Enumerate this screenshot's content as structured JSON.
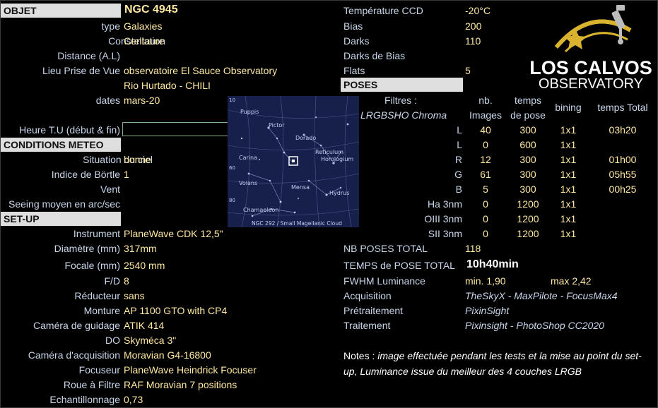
{
  "objet": {
    "header": "OBJET",
    "name": "NGC 4945",
    "rows": [
      {
        "label": "type",
        "value": "Galaxies"
      },
      {
        "label": "Constellation",
        "value": "Centaure"
      },
      {
        "label": "Distance (A.L)",
        "value": ""
      },
      {
        "label": "Lieu Prise de Vue",
        "value": "observatoire El Sauce Observatory"
      },
      {
        "label": "",
        "value": "Rio Hurtado - CHILI"
      },
      {
        "label": "dates",
        "value": "mars-20"
      }
    ],
    "heure_label": "Heure T.U (début & fin)",
    "heure_value": ""
  },
  "meteo": {
    "header": "CONDITIONS METEO",
    "rows": [
      {
        "label": "Situation du ciel",
        "value": "bonne"
      },
      {
        "label": "Indice de Börtle",
        "value": "1"
      },
      {
        "label": "Vent",
        "value": ""
      },
      {
        "label": "Seeing moyen en arc/sec",
        "value": ""
      }
    ]
  },
  "setup": {
    "header": "SET-UP",
    "rows": [
      {
        "label": "Instrument",
        "value": "PlaneWave CDK 12,5\""
      },
      {
        "label": "Diamètre (mm)",
        "value": "317mm"
      },
      {
        "label": "Focale (mm)",
        "value": "2540 mm"
      },
      {
        "label": "F/D",
        "value": "8"
      },
      {
        "label": "Réducteur",
        "value": "sans"
      },
      {
        "label": "Monture",
        "value": "AP 1100 GTO with CP4"
      },
      {
        "label": "Caméra de guidage",
        "value": "ATIK 414"
      },
      {
        "label": "DO",
        "value": "Skyméca 3\""
      },
      {
        "label": "Caméra d'acquisition",
        "value": "Moravian G4-16800"
      },
      {
        "label": "Focuseur",
        "value": "PlaneWave Heindrick Focuser"
      },
      {
        "label": "Roue à Filtre",
        "value": "RAF Moravian 7 positions"
      },
      {
        "label": "Echantillonnage",
        "value": "0,73"
      }
    ]
  },
  "camera": {
    "rows": [
      {
        "label": "Température CCD",
        "value": "-20°C"
      },
      {
        "label": "Bias",
        "value": "200"
      },
      {
        "label": "Darks",
        "value": "110"
      },
      {
        "label": "Darks de Bias",
        "value": ""
      },
      {
        "label": "Flats",
        "value": "5"
      }
    ]
  },
  "poses": {
    "header": "POSES",
    "filtres_label": "Filtres :",
    "filtres_sub": "LRGBSHO Chroma",
    "col_nb": [
      "nb.",
      "Images"
    ],
    "col_temps": [
      "temps",
      "de pose"
    ],
    "col_bining": "bining",
    "col_total": "temps Total",
    "rows": [
      {
        "filter": "L",
        "nb": "40",
        "temps": "300",
        "bin": "1x1",
        "total": "03h20"
      },
      {
        "filter": "L",
        "nb": "0",
        "temps": "600",
        "bin": "1x1",
        "total": ""
      },
      {
        "filter": "R",
        "nb": "12",
        "temps": "300",
        "bin": "1x1",
        "total": "01h00"
      },
      {
        "filter": "G",
        "nb": "61",
        "temps": "300",
        "bin": "1x1",
        "total": "05h55"
      },
      {
        "filter": "B",
        "nb": "5",
        "temps": "300",
        "bin": "1x1",
        "total": "00h25"
      },
      {
        "filter": "Ha 3nm",
        "nb": "0",
        "temps": "1200",
        "bin": "1x1",
        "total": ""
      },
      {
        "filter": "OIII 3nm",
        "nb": "0",
        "temps": "1200",
        "bin": "1x1",
        "total": ""
      },
      {
        "filter": "SII 3nm",
        "nb": "0",
        "temps": "1200",
        "bin": "1x1",
        "total": ""
      }
    ],
    "nb_total_label": "NB POSES TOTAL",
    "nb_total_value": "118",
    "temps_total_label": "TEMPS de POSE TOTAL",
    "temps_total_value": "10h40min",
    "fwhm_label": "FWHM Luminance",
    "fwhm_min": "min. 1,90",
    "fwhm_max": "max 2,42",
    "acquisition_label": "Acquisition",
    "acquisition_value": "TheSkyX - MaxPilote - FocusMax4",
    "pretraitement_label": "Prétraitement",
    "pretraitement_value": "PixinSight",
    "traitement_label": "Traitement",
    "traitement_value": "Pixinsight - PhotoShop CC2020"
  },
  "notes": {
    "label": "Notes :",
    "text": "image effectuée pendant les tests et la mise au point du set-up, Luminance issue du meilleur des 4 couches LRGB"
  },
  "finder": {
    "labels": [
      "Puppis",
      "Pictor",
      "Dorado",
      "Carina",
      "Reticulum",
      "Horologium",
      "Volans",
      "Mensa",
      "Hydrus",
      "Chamaeleon"
    ],
    "caption": "NGC 292 / Small Magellanic Cloud",
    "ticks": [
      "10",
      "60",
      "80"
    ]
  },
  "logo": {
    "line1": "LOS CALVOS",
    "line2": "OBSERVATORY"
  },
  "colors": {
    "label": "#c7d6ea",
    "value": "#ffe8a0",
    "band": "#dedede",
    "finder_bg": "#17204a",
    "logo_gold": "#d9b32e"
  }
}
